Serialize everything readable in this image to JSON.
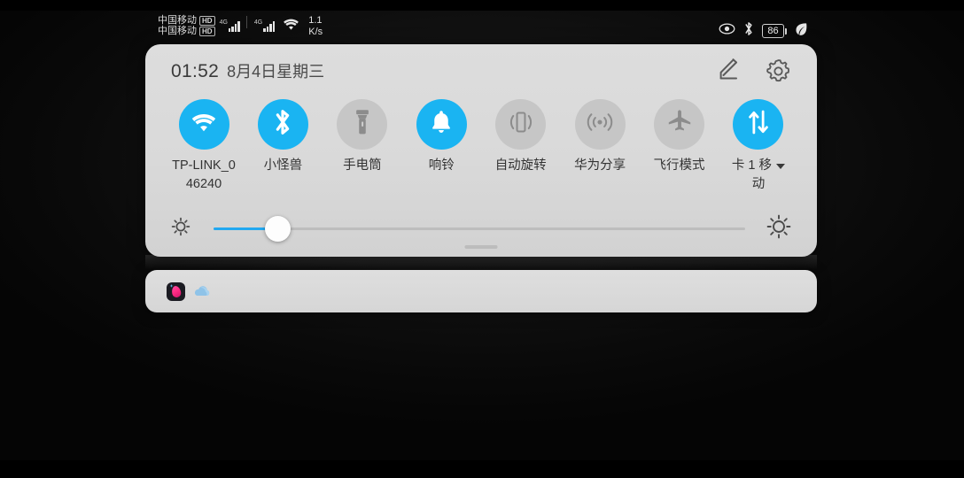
{
  "statusbar": {
    "carrier_line1": "中国移动",
    "carrier_line2": "中国移动",
    "hd_badge": "HD",
    "network_type_1": "4G",
    "network_type_2": "4G",
    "net_speed_value": "1.1",
    "net_speed_unit": "K/s",
    "battery_percent": "86",
    "icons": [
      "eye-icon",
      "bluetooth-icon",
      "battery-icon",
      "leaf-icon"
    ]
  },
  "panel": {
    "time": "01:52",
    "date": "8月4日星期三",
    "edit_label": "编辑",
    "settings_label": "设置"
  },
  "toggles": [
    {
      "id": "wifi",
      "icon": "wifi-icon",
      "label_line1": "TP-LINK_0",
      "label_line2": "46240",
      "active": true,
      "has_caret": false
    },
    {
      "id": "bluetooth",
      "icon": "bluetooth-icon",
      "label_line1": "小怪兽",
      "label_line2": "",
      "active": true,
      "has_caret": false
    },
    {
      "id": "flashlight",
      "icon": "flashlight-icon",
      "label_line1": "手电筒",
      "label_line2": "",
      "active": false,
      "has_caret": false
    },
    {
      "id": "ring",
      "icon": "bell-icon",
      "label_line1": "响铃",
      "label_line2": "",
      "active": true,
      "has_caret": false
    },
    {
      "id": "autorotate",
      "icon": "rotate-icon",
      "label_line1": "自动旋转",
      "label_line2": "",
      "active": false,
      "has_caret": false
    },
    {
      "id": "huaweishare",
      "icon": "huawei-share-icon",
      "label_line1": "华为分享",
      "label_line2": "",
      "active": false,
      "has_caret": false
    },
    {
      "id": "airplane",
      "icon": "airplane-icon",
      "label_line1": "飞行模式",
      "label_line2": "",
      "active": false,
      "has_caret": false
    },
    {
      "id": "mobiledata",
      "icon": "data-transfer-icon",
      "label_line1": "卡 1 移",
      "label_line2": "动",
      "active": true,
      "has_caret": true
    }
  ],
  "brightness": {
    "value_percent": 12,
    "low_icon": "brightness-low-icon",
    "high_icon": "brightness-high-icon"
  },
  "notifications": [
    {
      "id": "app-notification",
      "icon": "app-icon"
    },
    {
      "id": "weather-notification",
      "icon": "cloud-icon"
    }
  ],
  "colors": {
    "accent_blue": "#1ab4f2",
    "panel_bg": "#d9d9d9",
    "toggle_off": "#c6c6c6",
    "slider_fill": "#22a8f0"
  }
}
